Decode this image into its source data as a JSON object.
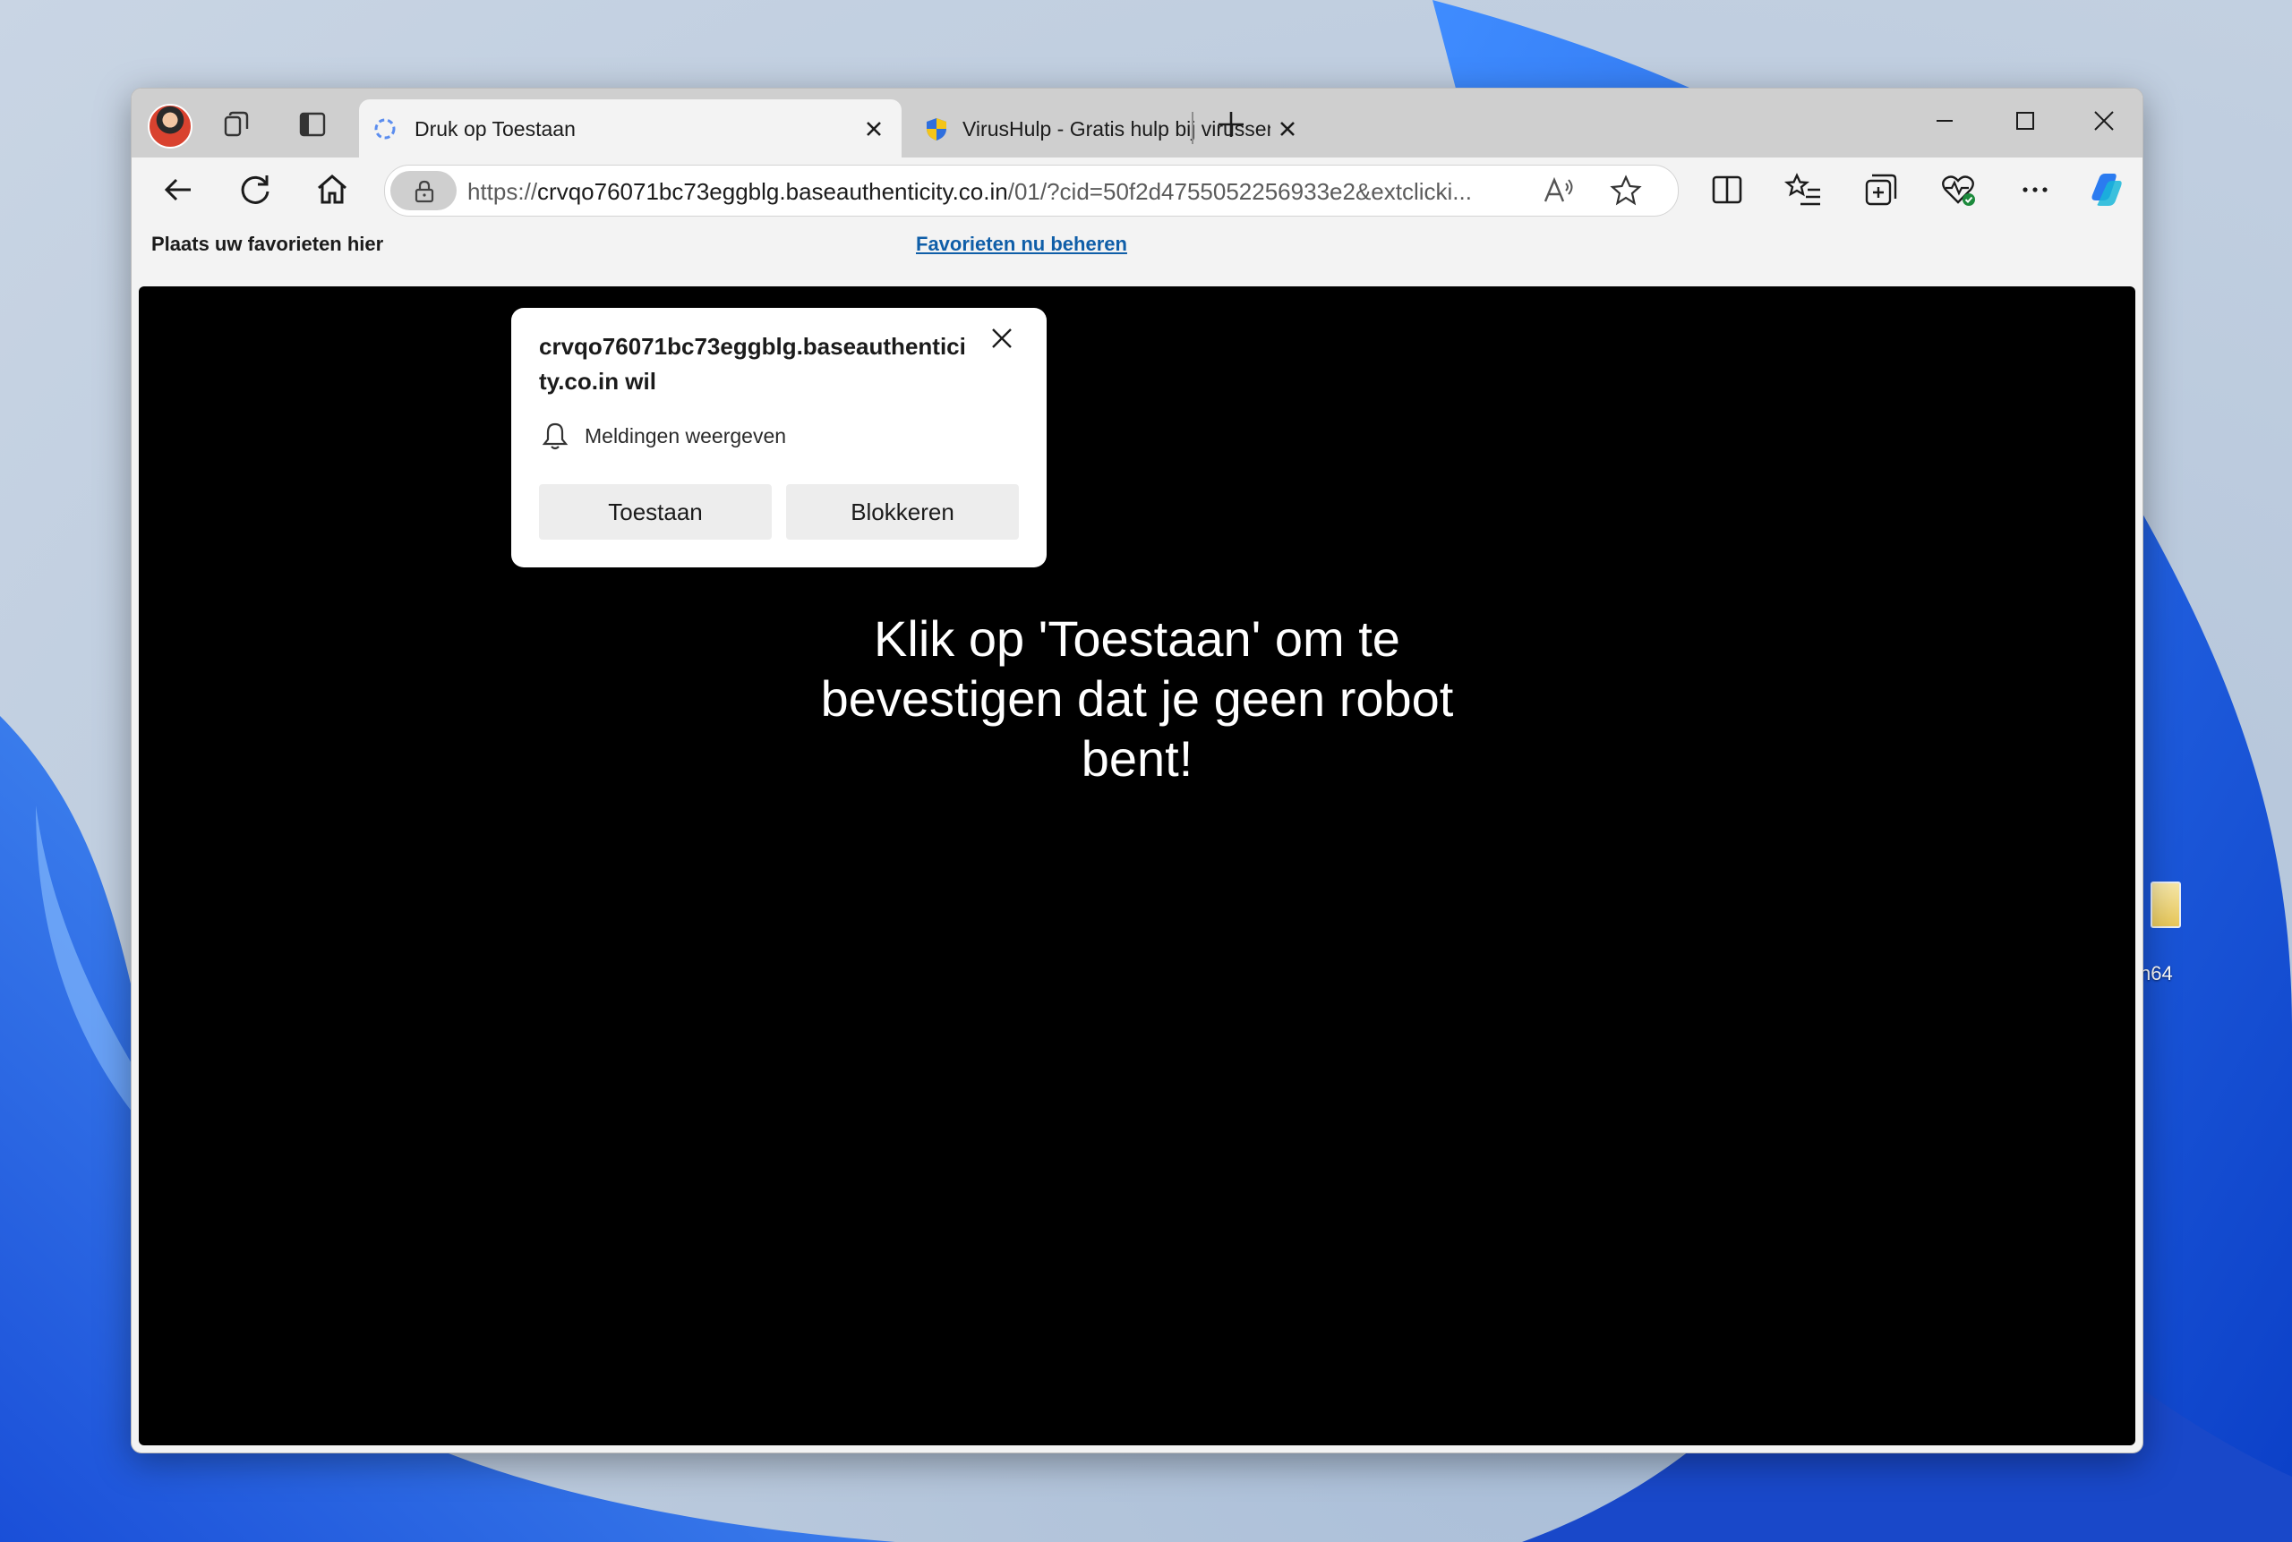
{
  "desktop": {
    "icon_label": "n64"
  },
  "browser": {
    "tabs": [
      {
        "title": "Druk op Toestaan",
        "active": true,
        "favicon": "spinner-favicon"
      },
      {
        "title": "VirusHulp - Gratis hulp bij virussen",
        "active": false,
        "favicon": "shield-favicon"
      }
    ],
    "address": {
      "url_prefix": "https://",
      "url_host": "crvqo76071bc73eggblg.baseauthenticity.co.in",
      "url_rest": "/01/?cid=50f2d4755052256933e2&extclicki..."
    },
    "favorites_bar": {
      "hint": "Plaats uw favorieten hier",
      "manage_link": "Favorieten nu beheren"
    },
    "page": {
      "message": "Klik op 'Toestaan' om te bevestigen dat je geen robot bent!",
      "background": "#000000"
    }
  },
  "permission_popup": {
    "title": "crvqo76071bc73eggblg.baseauthenticity.co.in wil",
    "permission": "Meldingen weergeven",
    "allow_label": "Toestaan",
    "block_label": "Blokkeren"
  },
  "colors": {
    "accent_link": "#0f5ea8",
    "tabbar": "#cfcfcf",
    "toolbar": "#f3f3f3"
  }
}
